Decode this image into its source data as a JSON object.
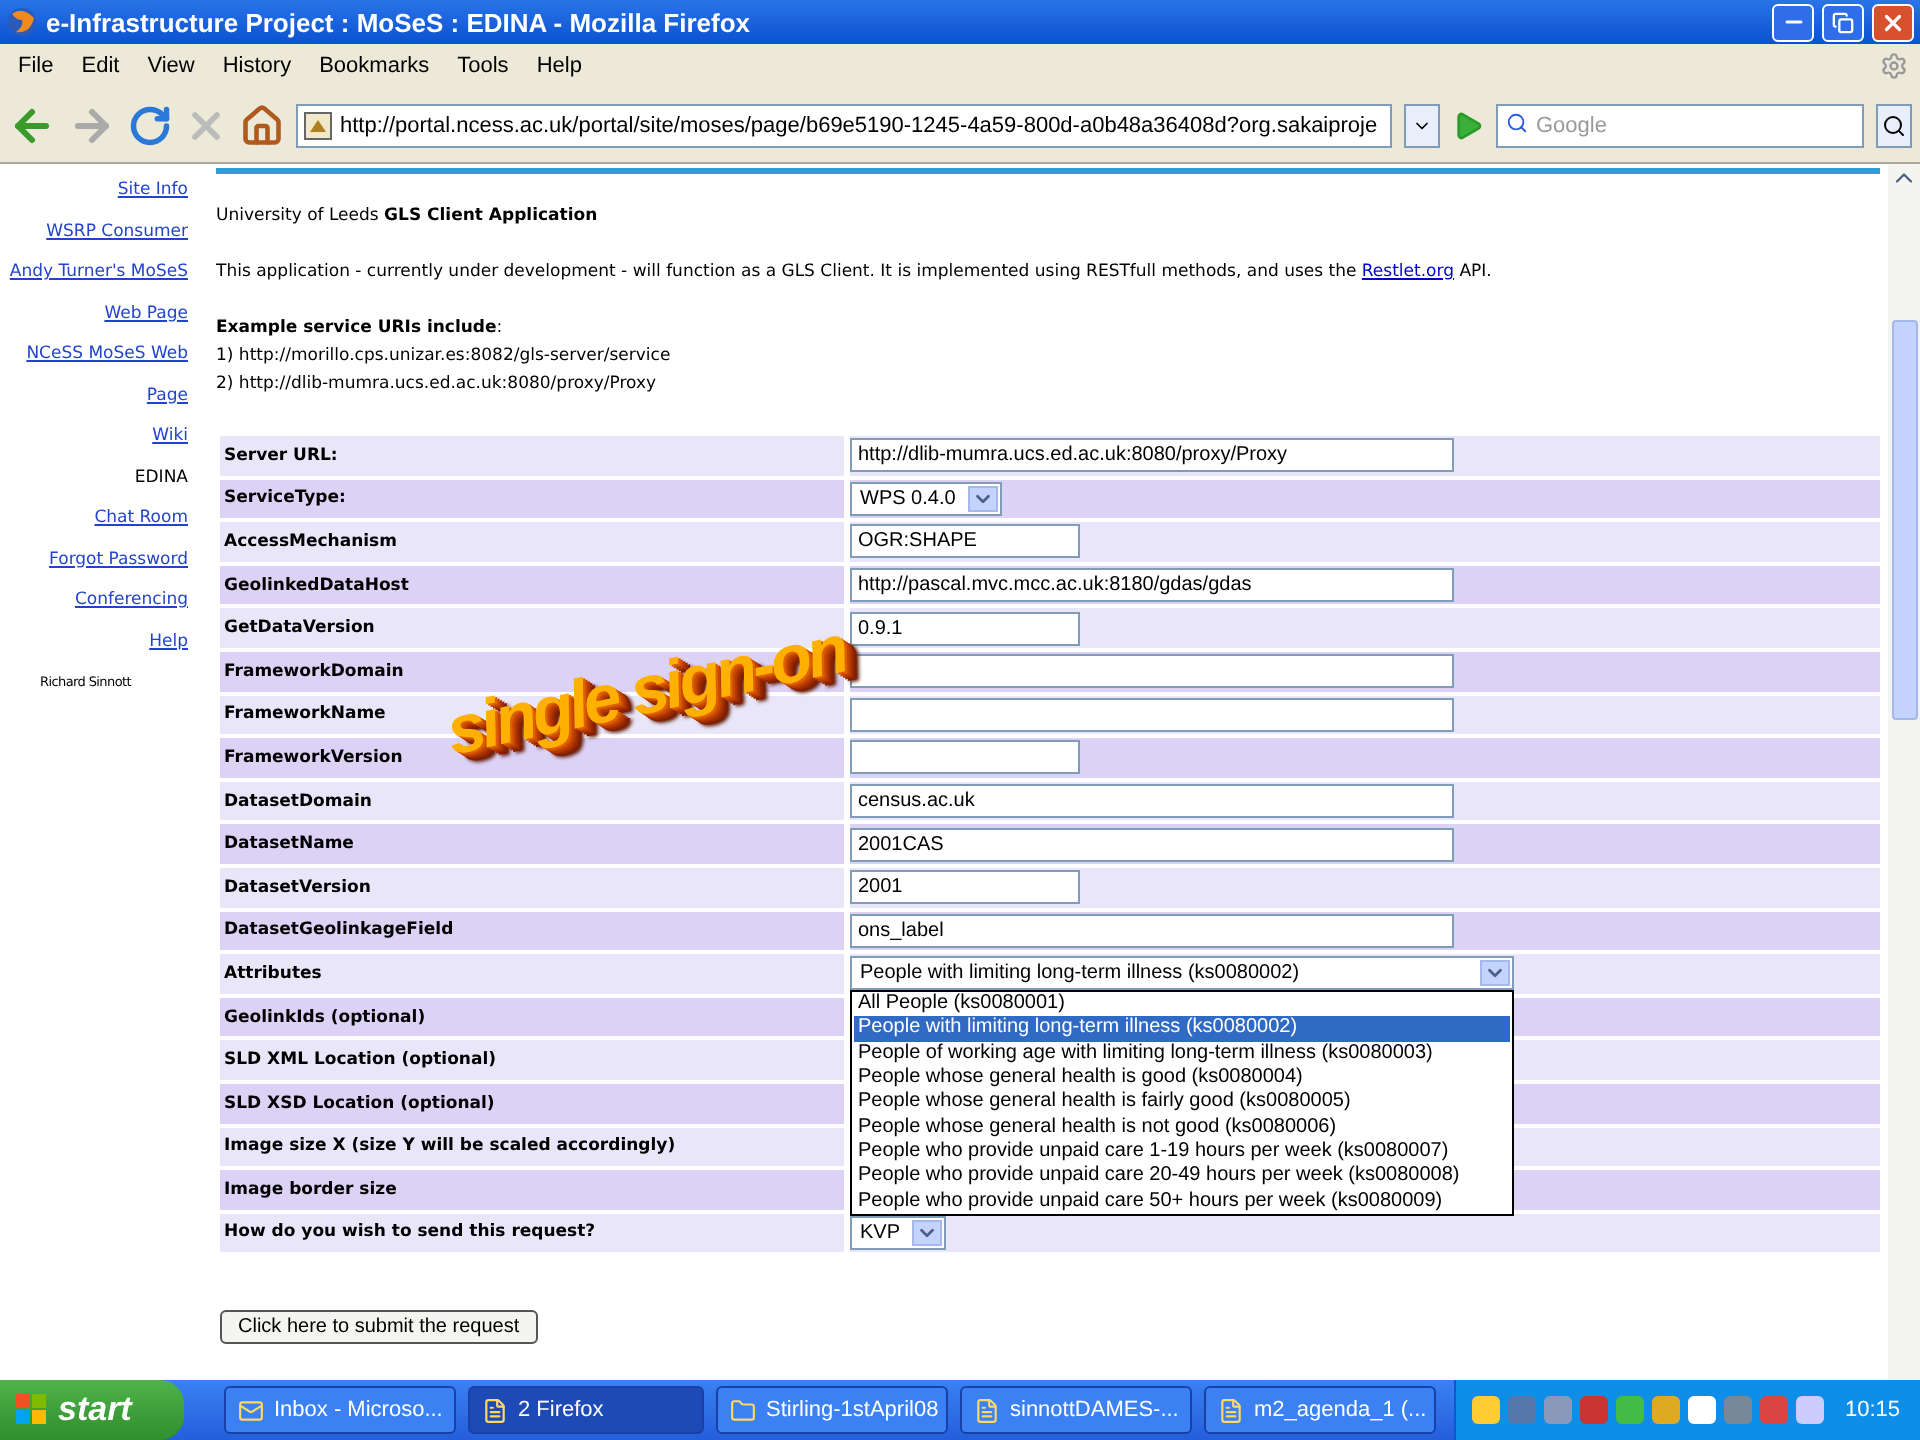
{
  "window": {
    "title": "e-Infrastructure Project : MoSeS : EDINA - Mozilla Firefox"
  },
  "menu": [
    "File",
    "Edit",
    "View",
    "History",
    "Bookmarks",
    "Tools",
    "Help"
  ],
  "toolbar": {
    "url": "http://portal.ncess.ac.uk/portal/site/moses/page/b69e5190-1245-4a59-800d-a0b48a36408d?org.sakaiproje",
    "search_placeholder": "Google"
  },
  "sidebar": {
    "items": [
      {
        "label": "Site Info",
        "kind": "link"
      },
      {
        "label": "WSRP Consumer",
        "kind": "link"
      },
      {
        "label": "Andy Turner's MoSeS Web Page",
        "kind": "link"
      },
      {
        "label": "NCeSS MoSeS Web Page",
        "kind": "link"
      },
      {
        "label": "Wiki",
        "kind": "link"
      },
      {
        "label": "EDINA",
        "kind": "current"
      },
      {
        "label": "Chat Room",
        "kind": "link"
      },
      {
        "label": "Forgot Password",
        "kind": "link"
      },
      {
        "label": "Conferencing",
        "kind": "link"
      },
      {
        "label": "Help",
        "kind": "link"
      }
    ],
    "user": "Richard Sinnott"
  },
  "content": {
    "heading": "University of Leeds **GLS Client Application**",
    "intro": {
      "before": "This application - currently under development - will function as a GLS Client. It is implemented using RESTfull methods, and uses the",
      "link": "Restlet.org",
      "after": "API."
    },
    "examples_heading": "**Example service URIs include**:",
    "examples": [
      "1) http://morillo.cps.unizar.es:8082/gls-server/service",
      "2) http://dlib-mumra.ucs.ed.ac.uk:8080/proxy/Proxy"
    ]
  },
  "form": {
    "rows": [
      {
        "label": "Server URL:",
        "kind": "wide",
        "value": "http://dlib-mumra.ucs.ed.ac.uk:8080/proxy/Proxy"
      },
      {
        "label": "ServiceType:",
        "kind": "select",
        "value": "WPS 0.4.0"
      },
      {
        "label": "AccessMechanism",
        "kind": "narrow",
        "value": "OGR:SHAPE"
      },
      {
        "label": "GeolinkedDataHost",
        "kind": "wide",
        "value": "http://pascal.mvc.mcc.ac.uk:8180/gdas/gdas"
      },
      {
        "label": "GetDataVersion",
        "kind": "narrow",
        "value": "0.9.1"
      },
      {
        "label": "FrameworkDomain",
        "kind": "wide"
      },
      {
        "label": "FrameworkName",
        "kind": "wide"
      },
      {
        "label": "FrameworkVersion",
        "kind": "narrow"
      },
      {
        "label": "DatasetDomain",
        "kind": "wide",
        "value": "census.ac.uk"
      },
      {
        "label": "DatasetName",
        "kind": "wide",
        "value": "2001CAS"
      },
      {
        "label": "DatasetVersion",
        "kind": "narrow",
        "value": "2001"
      },
      {
        "label": "DatasetGeolinkageField",
        "kind": "wide",
        "value": "ons_label"
      },
      {
        "label": "Attributes",
        "kind": "dropdown",
        "value": "People with limiting long-term illness (ks0080002)",
        "expanded": true,
        "options": [
          {
            "label": "All People (ks0080001)",
            "selected": false
          },
          {
            "label": "People with limiting long-term illness (ks0080002)",
            "selected": true
          },
          {
            "label": "People of working age with limiting long-term illness (ks0080003)",
            "selected": false
          },
          {
            "label": "People whose general health is good (ks0080004)",
            "selected": false
          },
          {
            "label": "People whose general health is fairly good (ks0080005)",
            "selected": false
          },
          {
            "label": "People whose general health is not good (ks0080006)",
            "selected": false
          },
          {
            "label": "People who provide unpaid care 1-19 hours per week (ks0080007)",
            "selected": false
          },
          {
            "label": "People who provide unpaid care 20-49 hours per week (ks0080008)",
            "selected": false
          },
          {
            "label": "People who provide unpaid care 50+ hours per week (ks0080009)",
            "selected": false
          }
        ]
      },
      {
        "label": "GeolinkIds (optional)",
        "kind": "empty"
      },
      {
        "label": "SLD XML Location (optional)",
        "kind": "empty"
      },
      {
        "label": "SLD XSD Location (optional)",
        "kind": "empty"
      },
      {
        "label": "Image size X (size Y will be scaled accordingly)",
        "kind": "empty"
      },
      {
        "label": "Image border size",
        "kind": "empty"
      },
      {
        "label": "How do you wish to send this request?",
        "kind": "select",
        "value": "KVP"
      }
    ],
    "submit": "Click here to submit the request"
  },
  "banner": "single sign-on",
  "taskbar": {
    "start": "start",
    "items": [
      {
        "label": "Inbox - Microso...",
        "selected": false
      },
      {
        "label": "2 Firefox",
        "selected": true
      },
      {
        "label": "Stirling-1stApril08",
        "selected": false
      },
      {
        "label": "sinnottDAMES-...",
        "selected": false
      },
      {
        "label": "m2_agenda_1 (...",
        "selected": false
      }
    ],
    "clock": "10:15"
  }
}
